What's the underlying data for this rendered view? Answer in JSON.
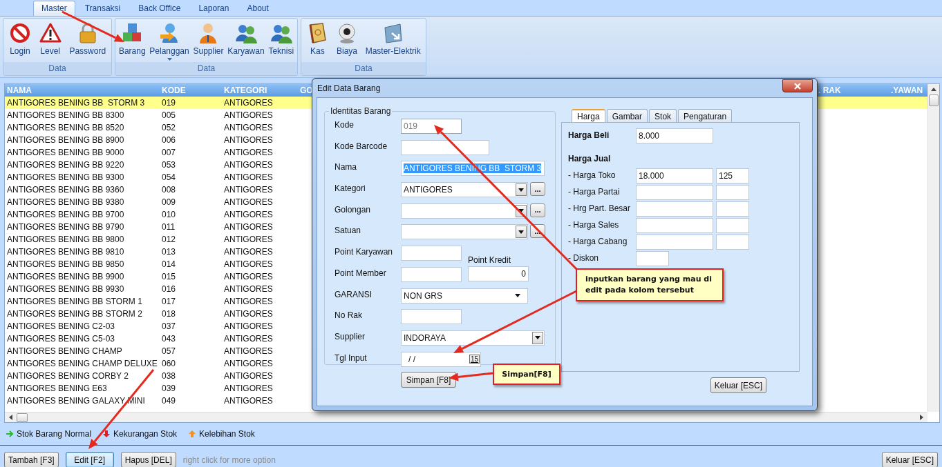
{
  "ribbon": {
    "tabs": [
      {
        "label": "Master",
        "selected": true
      },
      {
        "label": "Transaksi",
        "selected": false
      },
      {
        "label": "Back Office",
        "selected": false
      },
      {
        "label": "Laporan",
        "selected": false
      },
      {
        "label": "About",
        "selected": false
      }
    ],
    "groups": [
      {
        "label": "Data",
        "items": [
          {
            "label": "Login",
            "has_menu": false
          },
          {
            "label": "Level",
            "has_menu": false
          },
          {
            "label": "Password",
            "has_menu": false
          }
        ]
      },
      {
        "label": "Data",
        "items": [
          {
            "label": "Barang",
            "has_menu": false
          },
          {
            "label": "Pelanggan",
            "has_menu": true
          },
          {
            "label": "Supplier",
            "has_menu": false
          },
          {
            "label": "Karyawan",
            "has_menu": false
          },
          {
            "label": "Teknisi",
            "has_menu": false
          }
        ]
      },
      {
        "label": "Data",
        "items": [
          {
            "label": "Kas",
            "has_menu": false
          },
          {
            "label": "Biaya",
            "has_menu": false
          },
          {
            "label": "Master-Elektrik",
            "has_menu": false
          }
        ]
      }
    ]
  },
  "table": {
    "columns": [
      "NAMA",
      "KODE",
      "KATEGORI",
      "GO",
      ". RAK",
      ".YAWAN"
    ],
    "rows": [
      {
        "cells": [
          "ANTIGORES BENING BB  STORM 3",
          "019",
          "ANTIGORES"
        ],
        "selected": true
      },
      {
        "cells": [
          "ANTIGORES BENING BB 8300",
          "005",
          "ANTIGORES"
        ],
        "selected": false
      },
      {
        "cells": [
          "ANTIGORES BENING BB 8520",
          "052",
          "ANTIGORES"
        ],
        "selected": false
      },
      {
        "cells": [
          "ANTIGORES BENING BB 8900",
          "006",
          "ANTIGORES"
        ],
        "selected": false
      },
      {
        "cells": [
          "ANTIGORES BENING BB 9000",
          "007",
          "ANTIGORES"
        ],
        "selected": false
      },
      {
        "cells": [
          "ANTIGORES BENING BB 9220",
          "053",
          "ANTIGORES"
        ],
        "selected": false
      },
      {
        "cells": [
          "ANTIGORES BENING BB 9300",
          "054",
          "ANTIGORES"
        ],
        "selected": false
      },
      {
        "cells": [
          "ANTIGORES BENING BB 9360",
          "008",
          "ANTIGORES"
        ],
        "selected": false
      },
      {
        "cells": [
          "ANTIGORES BENING BB 9380",
          "009",
          "ANTIGORES"
        ],
        "selected": false
      },
      {
        "cells": [
          "ANTIGORES BENING BB 9700",
          "010",
          "ANTIGORES"
        ],
        "selected": false
      },
      {
        "cells": [
          "ANTIGORES BENING BB 9790",
          "011",
          "ANTIGORES"
        ],
        "selected": false
      },
      {
        "cells": [
          "ANTIGORES BENING BB 9800",
          "012",
          "ANTIGORES"
        ],
        "selected": false
      },
      {
        "cells": [
          "ANTIGORES BENING BB 9810",
          "013",
          "ANTIGORES"
        ],
        "selected": false
      },
      {
        "cells": [
          "ANTIGORES BENING BB 9850",
          "014",
          "ANTIGORES"
        ],
        "selected": false
      },
      {
        "cells": [
          "ANTIGORES BENING BB 9900",
          "015",
          "ANTIGORES"
        ],
        "selected": false
      },
      {
        "cells": [
          "ANTIGORES BENING BB 9930",
          "016",
          "ANTIGORES"
        ],
        "selected": false
      },
      {
        "cells": [
          "ANTIGORES BENING BB STORM 1",
          "017",
          "ANTIGORES"
        ],
        "selected": false
      },
      {
        "cells": [
          "ANTIGORES BENING BB STORM 2",
          "018",
          "ANTIGORES"
        ],
        "selected": false
      },
      {
        "cells": [
          "ANTIGORES BENING C2-03",
          "037",
          "ANTIGORES"
        ],
        "selected": false
      },
      {
        "cells": [
          "ANTIGORES BENING C5-03",
          "043",
          "ANTIGORES"
        ],
        "selected": false
      },
      {
        "cells": [
          "ANTIGORES BENING CHAMP",
          "057",
          "ANTIGORES"
        ],
        "selected": false
      },
      {
        "cells": [
          "ANTIGORES BENING CHAMP DELUXE",
          "060",
          "ANTIGORES"
        ],
        "selected": false
      },
      {
        "cells": [
          "ANTIGORES BENING CORBY 2",
          "038",
          "ANTIGORES"
        ],
        "selected": false
      },
      {
        "cells": [
          "ANTIGORES BENING E63",
          "039",
          "ANTIGORES"
        ],
        "selected": false
      },
      {
        "cells": [
          "ANTIGORES BENING GALAXY MINI",
          "049",
          "ANTIGORES"
        ],
        "selected": false
      }
    ]
  },
  "legend": [
    {
      "label": "Stok Barang Normal"
    },
    {
      "label": "Kekurangan Stok"
    },
    {
      "label": "Kelebihan Stok"
    }
  ],
  "buttons": [
    {
      "label": "Tambah [F3]",
      "focused": false
    },
    {
      "label": "Edit [F2]",
      "focused": true
    },
    {
      "label": "Hapus [DEL]",
      "focused": false
    }
  ],
  "hint": "right click for more option",
  "exit_button": "Keluar [ESC]",
  "dialog": {
    "title": "Edit Data Barang",
    "group_title": "Identitas Barang",
    "fields": [
      {
        "label": "Kode",
        "kind": "text",
        "value": "019",
        "disabled": true,
        "highlighted": false
      },
      {
        "label": "Kode Barcode",
        "kind": "text",
        "disabled": false
      },
      {
        "label": "Nama",
        "kind": "text",
        "value": "ANTIGORES BENING BB  STORM 3",
        "disabled": false,
        "highlighted": true
      },
      {
        "label": "Kategori",
        "kind": "combo",
        "value": "ANTIGORES",
        "browse": "..."
      },
      {
        "label": "Golongan",
        "kind": "combo",
        "browse": "..."
      },
      {
        "label": "Satuan",
        "kind": "combo",
        "browse": "..."
      },
      {
        "label": "Point Karyawan",
        "kind": "text",
        "disabled": false
      },
      {
        "label": "Point Member",
        "kind": "text",
        "disabled": false,
        "side": {
          "label": "Point Kredit",
          "value": "0"
        }
      },
      {
        "label": "GARANSI",
        "kind": "dropdown",
        "value": "NON GRS"
      },
      {
        "label": "No Rak",
        "kind": "text",
        "disabled": false
      },
      {
        "label": "Supplier",
        "kind": "select",
        "value": "INDORAYA"
      },
      {
        "label": "Tgl Input",
        "kind": "date",
        "value": "/ /",
        "calendar": "15"
      }
    ],
    "save_button": "Simpan [F8]",
    "tabs": [
      {
        "label": "Harga",
        "selected": true
      },
      {
        "label": "Gambar",
        "selected": false
      },
      {
        "label": "Stok",
        "selected": false
      },
      {
        "label": "Pengaturan",
        "selected": false
      }
    ],
    "price": {
      "buy": {
        "label": "Harga Beli",
        "value": "8.000"
      },
      "sell_title": "Harga Jual",
      "rows": [
        {
          "label": "- Harga Toko",
          "kind": "pair",
          "value": "18.000",
          "extra": "125"
        },
        {
          "label": "- Harga Partai",
          "kind": "pair"
        },
        {
          "label": "- Hrg Part. Besar",
          "kind": "pair"
        },
        {
          "label": "- Harga Sales",
          "kind": "pair"
        },
        {
          "label": "- Harga Cabang",
          "kind": "pair"
        },
        {
          "label": "- Diskon",
          "kind": "single"
        }
      ]
    },
    "exit_button": "Keluar [ESC]"
  },
  "annotations": [
    {
      "text": "inputkan barang yang mau di edit pada kolom tersebut"
    },
    {
      "text": "Simpan[F8]"
    }
  ]
}
